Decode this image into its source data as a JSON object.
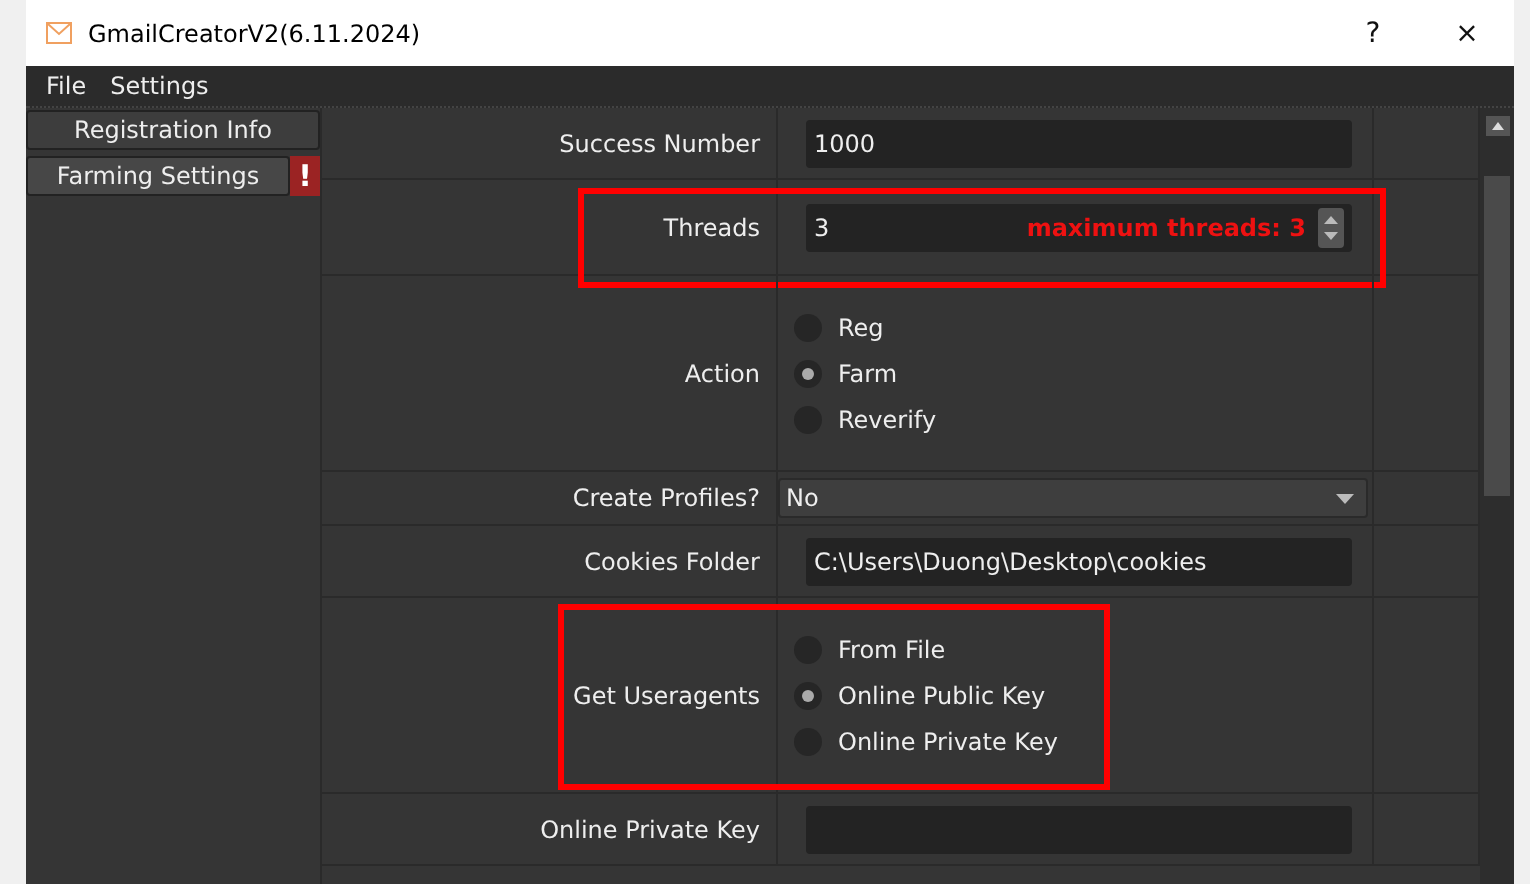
{
  "window": {
    "title": "GmailCreatorV2(6.11.2024)",
    "buttons": [
      "?",
      "×"
    ]
  },
  "menu": [
    "File",
    "Settings"
  ],
  "sidebar": {
    "items": [
      {
        "label": "Registration Info",
        "selected": false,
        "warning": false
      },
      {
        "label": "Farming Settings",
        "selected": true,
        "warning": true,
        "badge": "!"
      }
    ]
  },
  "form": {
    "rows": [
      {
        "kind": "input",
        "label": "Success Number",
        "value": "1000",
        "highlighted": false
      },
      {
        "kind": "spinbox",
        "label": "Threads",
        "value": "3",
        "note": "maximum threads: 3",
        "highlighted": true
      },
      {
        "kind": "radios",
        "label": "Action",
        "highlighted": false,
        "options": [
          {
            "label": "Reg",
            "selected": false
          },
          {
            "label": "Farm",
            "selected": true
          },
          {
            "label": "Reverify",
            "selected": false
          }
        ]
      },
      {
        "kind": "select",
        "label": "Create Profiles?",
        "value": "No",
        "highlighted": false
      },
      {
        "kind": "input",
        "label": "Cookies Folder",
        "value": "C:\\Users\\Duong\\Desktop\\cookies",
        "highlighted": false
      },
      {
        "kind": "radios",
        "label": "Get Useragents",
        "highlighted": true,
        "options": [
          {
            "label": "From File",
            "selected": false
          },
          {
            "label": "Online Public Key",
            "selected": true
          },
          {
            "label": "Online Private Key",
            "selected": false
          }
        ]
      },
      {
        "kind": "input",
        "label": "Online Private Key",
        "value": "",
        "highlighted": false
      }
    ]
  }
}
